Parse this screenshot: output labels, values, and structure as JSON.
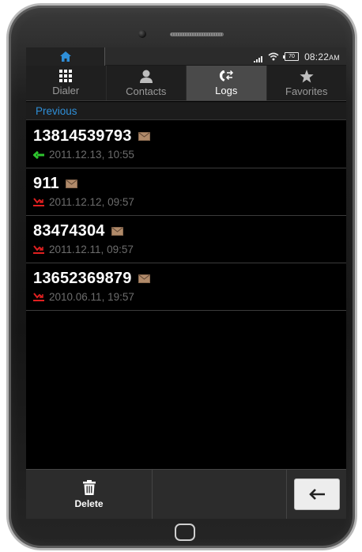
{
  "status_bar": {
    "home_icon": "home-icon",
    "time": "08:22",
    "time_suffix": "AM",
    "battery_label": "70"
  },
  "tabs": [
    {
      "label": "Dialer",
      "icon": "keypad-icon",
      "active": false
    },
    {
      "label": "Contacts",
      "icon": "person-icon",
      "active": false
    },
    {
      "label": "Logs",
      "icon": "call-log-icon",
      "active": true
    },
    {
      "label": "Favorites",
      "icon": "star-icon",
      "active": false
    }
  ],
  "section_header": "Previous",
  "logs": [
    {
      "number": "13814539793",
      "datetime": "2011.12.13, 10:55",
      "type": "incoming",
      "has_message": true
    },
    {
      "number": "911",
      "datetime": "2011.12.12, 09:57",
      "type": "missed",
      "has_message": true
    },
    {
      "number": "83474304",
      "datetime": "2011.12.11, 09:57",
      "type": "missed",
      "has_message": true
    },
    {
      "number": "13652369879",
      "datetime": "2010.06.11, 19:57",
      "type": "missed",
      "has_message": true
    }
  ],
  "bottom_bar": {
    "delete_label": "Delete",
    "delete_icon": "trash-icon",
    "back_icon": "back-arrow-icon"
  },
  "colors": {
    "accent_blue": "#2f8fd8",
    "incoming_green": "#2ec42e",
    "missed_red": "#e02020",
    "message_icon": "#b08a6a"
  }
}
